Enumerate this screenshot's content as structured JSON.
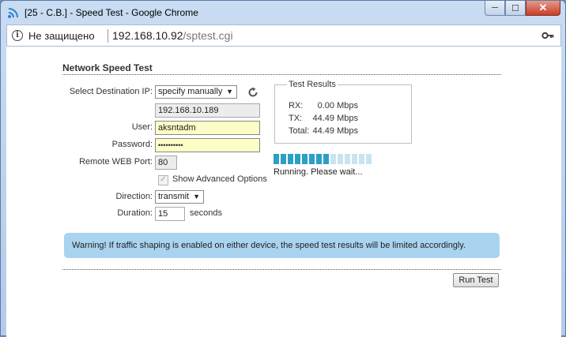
{
  "window": {
    "title": "[25 - C.B.] - Speed Test - Google Chrome",
    "minimize": "─",
    "maximize": "☐",
    "close": "✕"
  },
  "address": {
    "info_icon": "i",
    "security_label": "Не защищено",
    "host": "192.168.10.92",
    "path": "/sptest.cgi"
  },
  "form": {
    "title": "Network Speed Test",
    "destination_ip_label": "Select Destination IP:",
    "destination_mode": "specify manually",
    "destination_ip": "192.168.10.189",
    "user_label": "User:",
    "user_value": "aksntadm",
    "password_label": "Password:",
    "password_value": "••••••••••",
    "remote_port_label": "Remote WEB Port:",
    "remote_port": "80",
    "advanced_label": "Show Advanced Options",
    "advanced_check": "✓",
    "direction_label": "Direction:",
    "direction_value": "transmit",
    "duration_label": "Duration:",
    "duration_value": "15",
    "duration_unit": "seconds",
    "select_arrow": "▼"
  },
  "results": {
    "legend": "Test Results",
    "rx_label": "RX:",
    "rx_value": "0.00 Mbps",
    "tx_label": "TX:",
    "tx_value": "44.49 Mbps",
    "total_label": "Total:",
    "total_value": "44.49 Mbps"
  },
  "progress": {
    "segments_total": 14,
    "segments_done": 8,
    "status": "Running. Please wait..."
  },
  "warning": "Warning! If traffic shaping is enabled on either device, the speed test results will be limited accordingly.",
  "run_button": "Run Test",
  "colors": {
    "progress_on": "#2c9fc4",
    "progress_off": "#c8e4ef",
    "warning_bg": "#a9d3ef",
    "credential_bg": "#fdfdc8"
  }
}
